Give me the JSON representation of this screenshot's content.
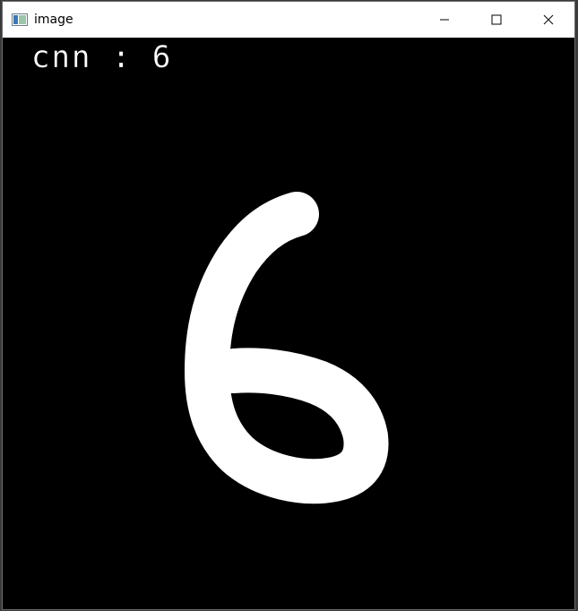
{
  "window": {
    "title": "image"
  },
  "icons": {
    "app": "app-window-icon",
    "minimize": "minimize-icon",
    "maximize": "maximize-icon",
    "close": "close-icon"
  },
  "canvas": {
    "prediction_label": "cnn : 6",
    "background_color": "#000000",
    "stroke_color": "#ffffff"
  }
}
